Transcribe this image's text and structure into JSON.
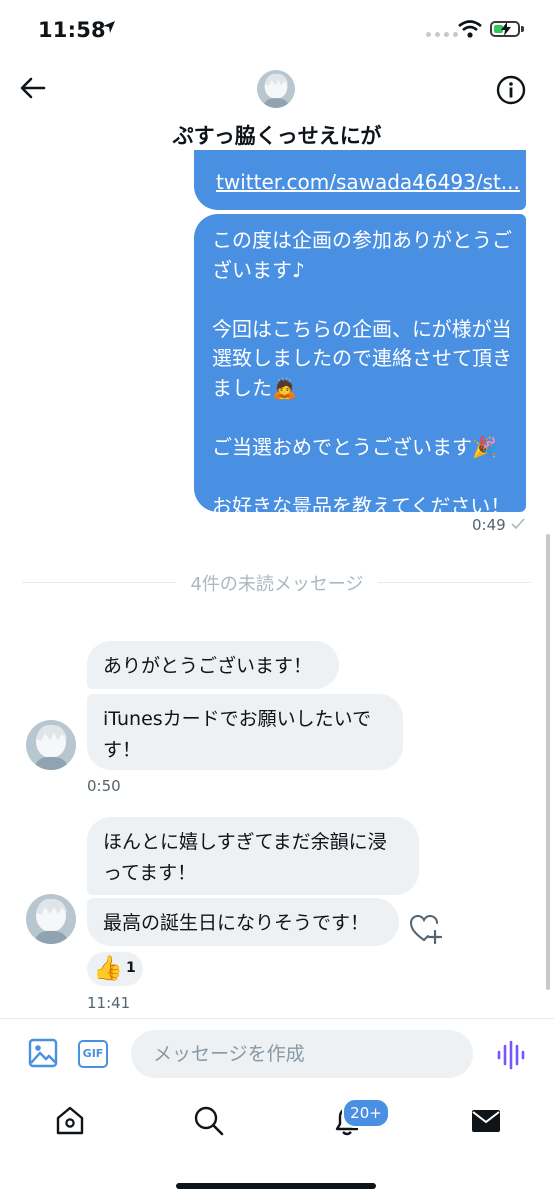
{
  "status_bar": {
    "time": "11:58"
  },
  "header": {
    "title": "ぷすっ脇くっせえにが",
    "back_icon": "arrow-left-icon",
    "info_icon": "info-icon"
  },
  "messages": {
    "outgoing_link": "twitter.com/sawada46493/st...",
    "outgoing_text": "この度は企画の参加ありがとうご\nざいます♪\n\n今回はこちらの企画、にが様が当\n選致しましたので連絡させて頂き\nました🙇\n\nご当選おめでとうございます🎉\n\nお好きな景品を教えてください！",
    "outgoing_time": "0:49",
    "unread_divider": "4件の未読メッセージ",
    "incoming_1": "ありがとうございます！",
    "incoming_2": "iTunesカードでお願いしたいで\nす！",
    "incoming_time_1": "0:50",
    "incoming_3": "ほんとに嬉しすぎてまだ余韻に浸\nってます！",
    "incoming_4": "最高の誕生日になりそうです！",
    "reaction_emoji": "👍",
    "reaction_count": "1",
    "incoming_time_2": "11:41"
  },
  "compose": {
    "gif_label": "GIF",
    "placeholder": "メッセージを作成"
  },
  "tab_bar": {
    "notifications_badge": "20+"
  },
  "colors": {
    "accent": "#4a90e2",
    "incoming_bubble": "#eef1f3",
    "voice": "#7856ff"
  }
}
